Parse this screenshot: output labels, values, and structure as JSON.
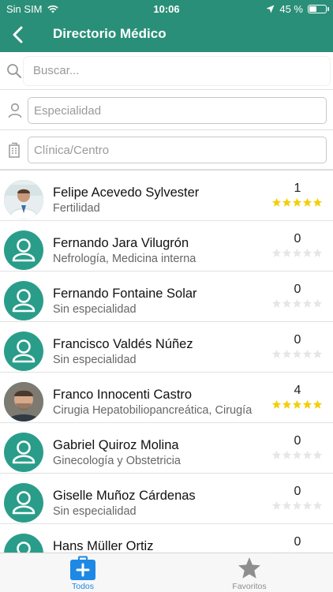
{
  "status": {
    "carrier": "Sin SIM",
    "time": "10:06",
    "battery_text": "45 %",
    "battery_level": 0.45
  },
  "nav": {
    "title": "Directorio Médico"
  },
  "search": {
    "placeholder": "Buscar..."
  },
  "filters": {
    "specialty_placeholder": "Especialidad",
    "clinic_placeholder": "Clínica/Centro"
  },
  "colors": {
    "primary": "#2a8f78",
    "avatar": "#2a9d8a",
    "star_filled": "#f2cf0c",
    "star_empty": "#e6e6e6",
    "tab_active": "#1e88e5",
    "tab_inactive": "#8e8e8e"
  },
  "doctors": [
    {
      "name": "Felipe Acevedo Sylvester",
      "specialty": "Fertilidad",
      "rating_count": "1",
      "stars": 5,
      "avatar": "photo"
    },
    {
      "name": "Fernando Jara Vilugrón",
      "specialty": "Nefrología, Medicina interna",
      "rating_count": "0",
      "stars": 0,
      "avatar": "person-icon"
    },
    {
      "name": "Fernando Fontaine Solar",
      "specialty": "Sin especialidad",
      "rating_count": "0",
      "stars": 0,
      "avatar": "person-icon"
    },
    {
      "name": "Francisco Valdés Núñez",
      "specialty": "Sin especialidad",
      "rating_count": "0",
      "stars": 0,
      "avatar": "person-icon"
    },
    {
      "name": "Franco Innocenti Castro",
      "specialty": "Cirugia Hepatobiliopancreática, Cirugía",
      "rating_count": "4",
      "stars": 5,
      "avatar": "photo"
    },
    {
      "name": "Gabriel Quiroz Molina",
      "specialty": "Ginecología y Obstetricia",
      "rating_count": "0",
      "stars": 0,
      "avatar": "person-icon"
    },
    {
      "name": "Giselle Muñoz Cárdenas",
      "specialty": "Sin especialidad",
      "rating_count": "0",
      "stars": 0,
      "avatar": "person-icon"
    },
    {
      "name": "Hans Müller Ortiz",
      "specialty": "",
      "rating_count": "0",
      "stars": 0,
      "avatar": "person-icon"
    }
  ],
  "tabs": {
    "all": "Todos",
    "favorites": "Favoritos"
  }
}
